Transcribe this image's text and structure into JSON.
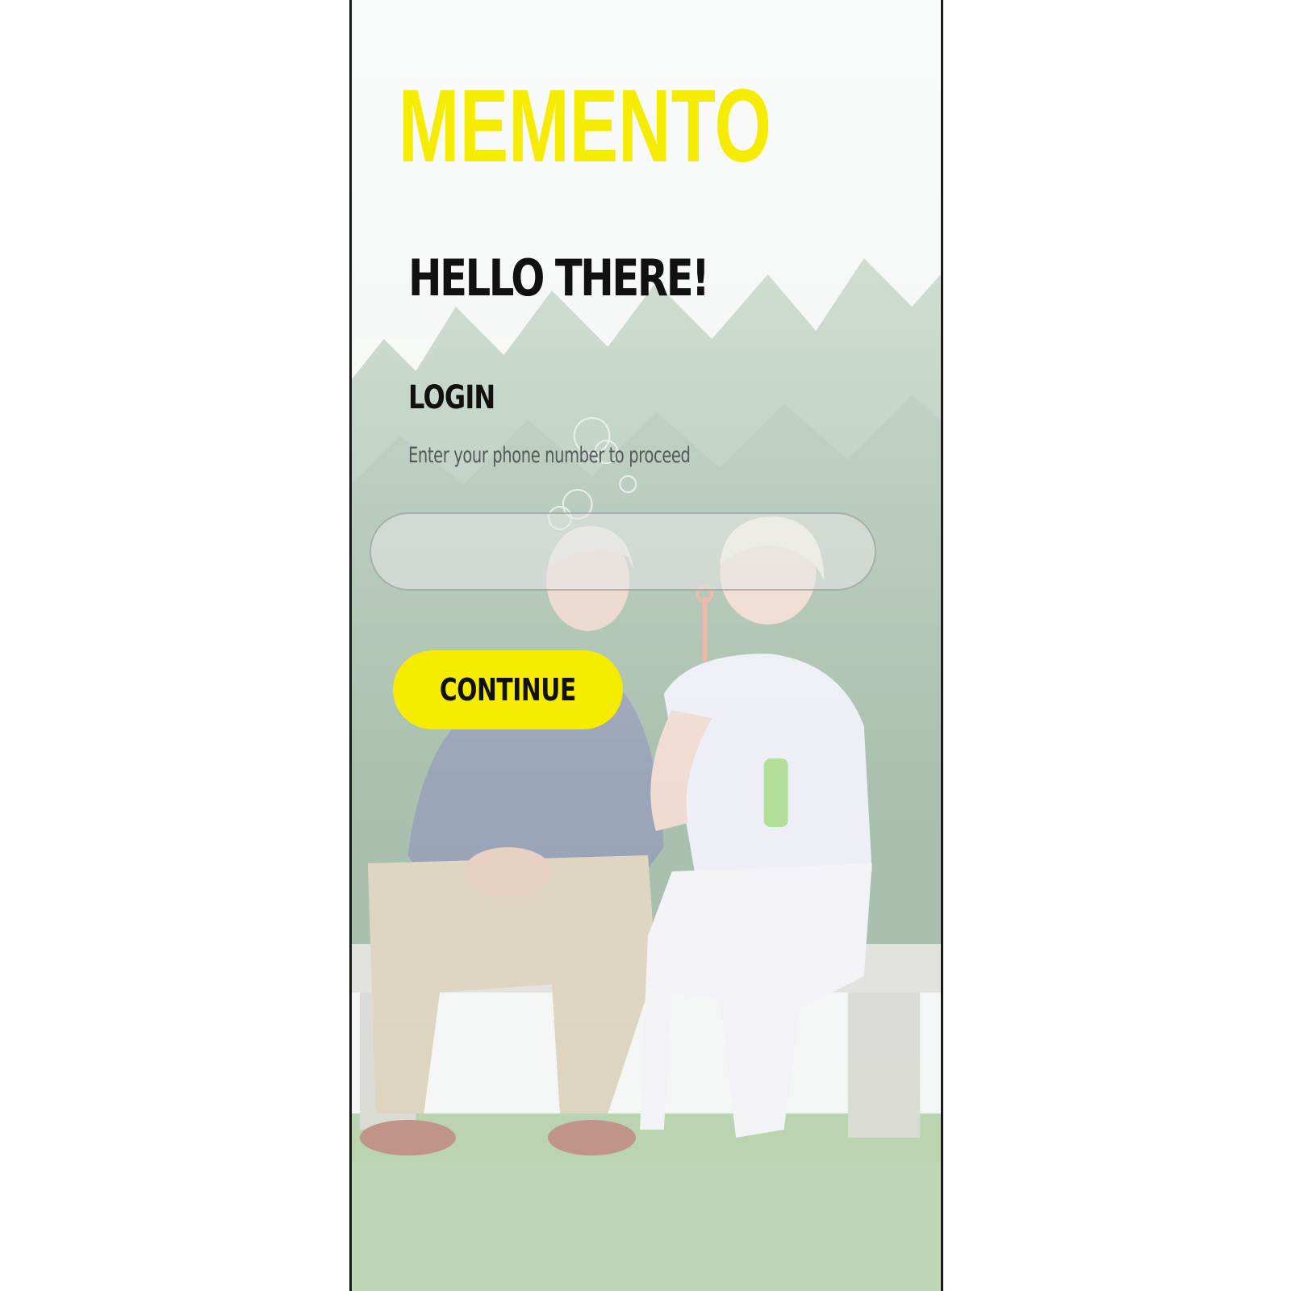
{
  "app": {
    "logo_text": "MEMENTO"
  },
  "login": {
    "greeting": "HELLO THERE!",
    "section_title": "LOGIN",
    "helper_text": "Enter your phone number to proceed",
    "phone_input": {
      "value": "",
      "placeholder": ""
    },
    "continue_label": "CONTINUE"
  },
  "colors": {
    "brand_yellow": "#f6ec00",
    "text_dark": "#111111",
    "text_muted": "#55585c"
  }
}
